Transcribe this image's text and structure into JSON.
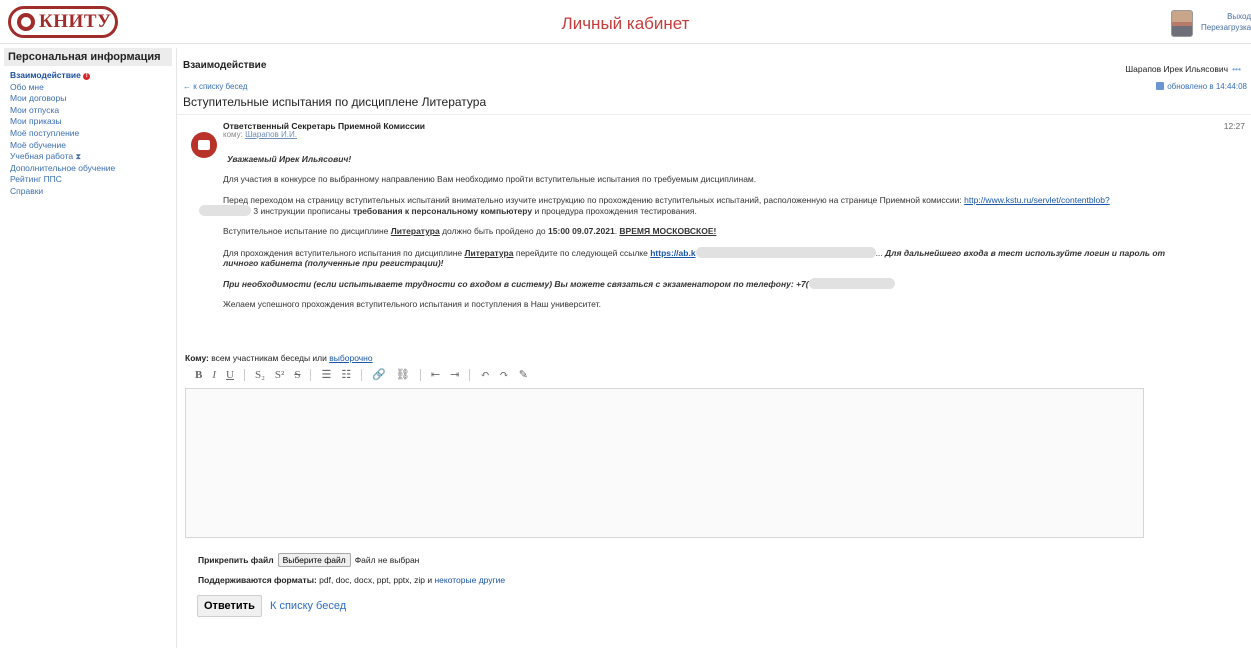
{
  "header": {
    "logo_text": "КНИТУ",
    "title": "Личный кабинет",
    "exit_label": "Выход",
    "reload_label": "Перезагрузка"
  },
  "sidebar": {
    "title": "Персональная информация",
    "items": [
      {
        "label": "Взаимодействие",
        "badge": "!"
      },
      {
        "label": "Обо мне"
      },
      {
        "label": "Мои договоры"
      },
      {
        "label": "Мои отпуска"
      },
      {
        "label": "Мои приказы"
      },
      {
        "label": "Моё поступление"
      },
      {
        "label": "Моё обучение"
      },
      {
        "label": "Учебная работа"
      },
      {
        "label": "Дополнительное обучение"
      },
      {
        "label": "Рейтинг ППС"
      },
      {
        "label": "Справки"
      }
    ]
  },
  "conversation": {
    "heading": "Взаимодействие",
    "owner": "Шарапов Ирек Ильясович",
    "owner_menu": "•••",
    "back_link": "← к списку бесед",
    "updated": "обновлено в 14:44:08",
    "subject": "Вступительные испытания по дисциплене Литература"
  },
  "message": {
    "sender": "Ответственный Секретарь Приемной Комиссии",
    "to_prefix": "кому:",
    "to_name": "Шарапов И.И.",
    "time": "12:27",
    "greeting": "Уважаемый Ирек Ильясович!",
    "p1": "Для участия в конкурсе по выбранному направлению Вам необходимо пройти вступительные испытания по требуемым дисциплинам.",
    "p2_a": "Перед переходом на страницу вступительных испытаний внимательно изучите инструкцию по прохождению вступительных испытаний, расположенную на странице Приемной комиссии:",
    "p2_link": "http://www.kstu.ru/servlet/contentblob?",
    "p2_b": "3 инструкции прописаны",
    "p2_bold": "требования к персональному компьютеру",
    "p2_c": "и процедура прохождения тестирования.",
    "p3_a": "Вступительное испытание по дисциплине",
    "p3_subject": "Литература",
    "p3_b": "должно быть пройдено до",
    "p3_deadline": "15:00 09.07.2021",
    "p3_tz": "ВРЕМЯ МОСКОВСКОЕ!",
    "p4_a": "Для прохождения вступительного испытания по дисциплине",
    "p4_subject": "Литература",
    "p4_b": "перейдите по следующей ссылке",
    "p4_link": "https://ab.k",
    "p4_link_end": "...",
    "p4_c": "Для дальнейшего входа в тест используйте логин и пароль от",
    "p4_d": "личного кабинета (полученные при регистрации)!",
    "p5": "При необходимости (если испытываете трудности со входом в систему) Вы можете связаться с экзаменатором по телефону: +7(",
    "p6": "Желаем успешного прохождения вступительного испытания и поступления в Наш университет."
  },
  "reply": {
    "to_label": "Кому:",
    "to_text": "всем участникам беседы или",
    "to_link": "выборочно",
    "toolbar": [
      "B",
      "I",
      "U",
      "S₂",
      "S²",
      "S",
      "☰",
      "☷",
      "🔗",
      "⛓",
      "⇤",
      "⇥",
      "↶",
      "↷",
      "✎"
    ],
    "attach_label": "Прикрепить файл",
    "file_button": "Выберите файл",
    "file_status": "Файл не выбран",
    "formats_label": "Поддерживаются форматы:",
    "formats_value": "pdf, doc, docx, ppt, pptx, zip и",
    "formats_more": "некоторые другие",
    "submit": "Ответить",
    "back": "К списку бесед"
  },
  "colors": {
    "brand": "#a12c2c",
    "title": "#c63c3c",
    "link": "#1a56a8"
  }
}
